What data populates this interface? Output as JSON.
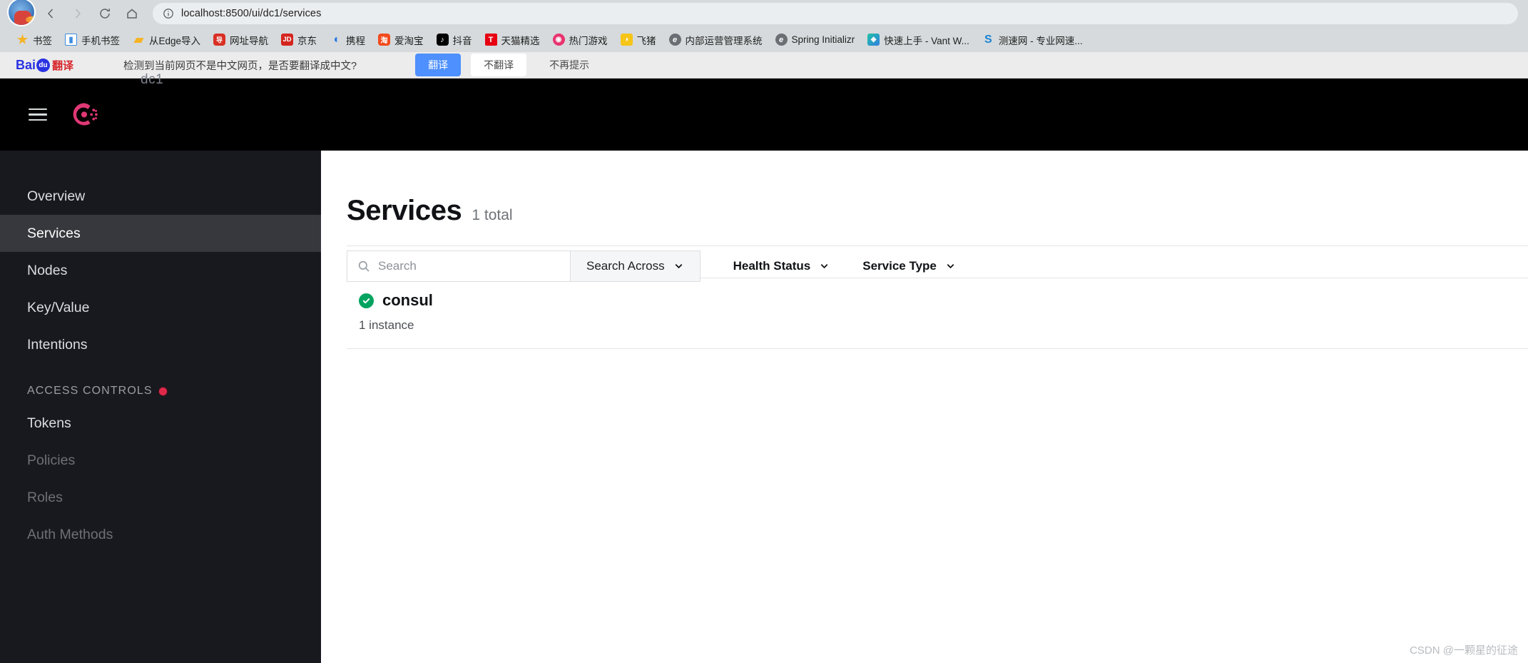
{
  "browser": {
    "url": "localhost:8500/ui/dc1/services",
    "nav": {
      "back_label": "Back",
      "forward_label": "Forward",
      "reload_label": "Reload",
      "home_label": "Home",
      "site_info_label": "Site information"
    },
    "avatar_label": "Profile",
    "bookmarks": [
      {
        "label": "书签",
        "icon": "star-icon",
        "glyph": "★",
        "cls": "ic-star"
      },
      {
        "label": "手机书签",
        "icon": "phone-bookmarks-icon",
        "glyph": "▮",
        "cls": "ic-phone"
      },
      {
        "label": "从Edge导入",
        "icon": "folder-icon",
        "glyph": "▰",
        "cls": "ic-folder"
      },
      {
        "label": "网址导航",
        "icon": "hao123-icon",
        "glyph": "导",
        "cls": "ic-hao123"
      },
      {
        "label": "京东",
        "icon": "jd-icon",
        "glyph": "JD",
        "cls": "ic-jd"
      },
      {
        "label": "携程",
        "icon": "ctrip-icon",
        "glyph": "◖",
        "cls": "ic-ctrip"
      },
      {
        "label": "爱淘宝",
        "icon": "taobao-icon",
        "glyph": "淘",
        "cls": "ic-taobao"
      },
      {
        "label": "抖音",
        "icon": "douyin-icon",
        "glyph": "♪",
        "cls": "ic-douyin"
      },
      {
        "label": "天猫精选",
        "icon": "tmall-icon",
        "glyph": "T",
        "cls": "ic-tmall"
      },
      {
        "label": "热门游戏",
        "icon": "games-icon",
        "glyph": "◉",
        "cls": "ic-game"
      },
      {
        "label": "飞猪",
        "icon": "fliggy-icon",
        "glyph": "◑",
        "cls": "ic-fz"
      },
      {
        "label": "内部运营管理系统",
        "icon": "edge-icon",
        "glyph": "e",
        "cls": "ic-edge"
      },
      {
        "label": "Spring Initializr",
        "icon": "edge-icon",
        "glyph": "e",
        "cls": "ic-spring"
      },
      {
        "label": "快速上手 - Vant W...",
        "icon": "vant-icon",
        "glyph": "◈",
        "cls": "ic-vant"
      },
      {
        "label": "测速网 - 专业网速...",
        "icon": "speedtest-icon",
        "glyph": "S",
        "cls": "ic-speed"
      }
    ]
  },
  "translate_bar": {
    "brand_bai": "Bai",
    "brand_paw": "du",
    "brand_suffix": "翻译",
    "message": "检测到当前网页不是中文网页，是否要翻译成中文?",
    "translate_label": "翻译",
    "no_translate_label": "不翻译",
    "never_label": "不再提示"
  },
  "app": {
    "datacenter_ghost": "dc1",
    "logo_label": "Consul",
    "menu_label": "Menu"
  },
  "sidebar": {
    "items": [
      {
        "label": "Overview",
        "state": ""
      },
      {
        "label": "Services",
        "state": "active"
      },
      {
        "label": "Nodes",
        "state": ""
      },
      {
        "label": "Key/Value",
        "state": ""
      },
      {
        "label": "Intentions",
        "state": ""
      }
    ],
    "section_label": "ACCESS CONTROLS",
    "acl_items": [
      {
        "label": "Tokens",
        "state": ""
      },
      {
        "label": "Policies",
        "state": "disabled"
      },
      {
        "label": "Roles",
        "state": "disabled"
      },
      {
        "label": "Auth Methods",
        "state": "disabled"
      }
    ]
  },
  "main": {
    "title": "Services",
    "total": "1 total",
    "search_placeholder": "Search",
    "search_value": "",
    "search_across_label": "Search Across",
    "health_status_label": "Health Status",
    "service_type_label": "Service Type",
    "services": [
      {
        "name": "consul",
        "health": "passing",
        "instances": "1 instance"
      }
    ]
  },
  "watermark": "CSDN @一颗星的征途",
  "colors": {
    "consul_pink": "#e03875",
    "sidebar_bg": "#17191e",
    "active_nav": "#36383d",
    "health_green": "#00a35f",
    "badge_red": "#e0294a",
    "translate_blue": "#4e90fd"
  }
}
